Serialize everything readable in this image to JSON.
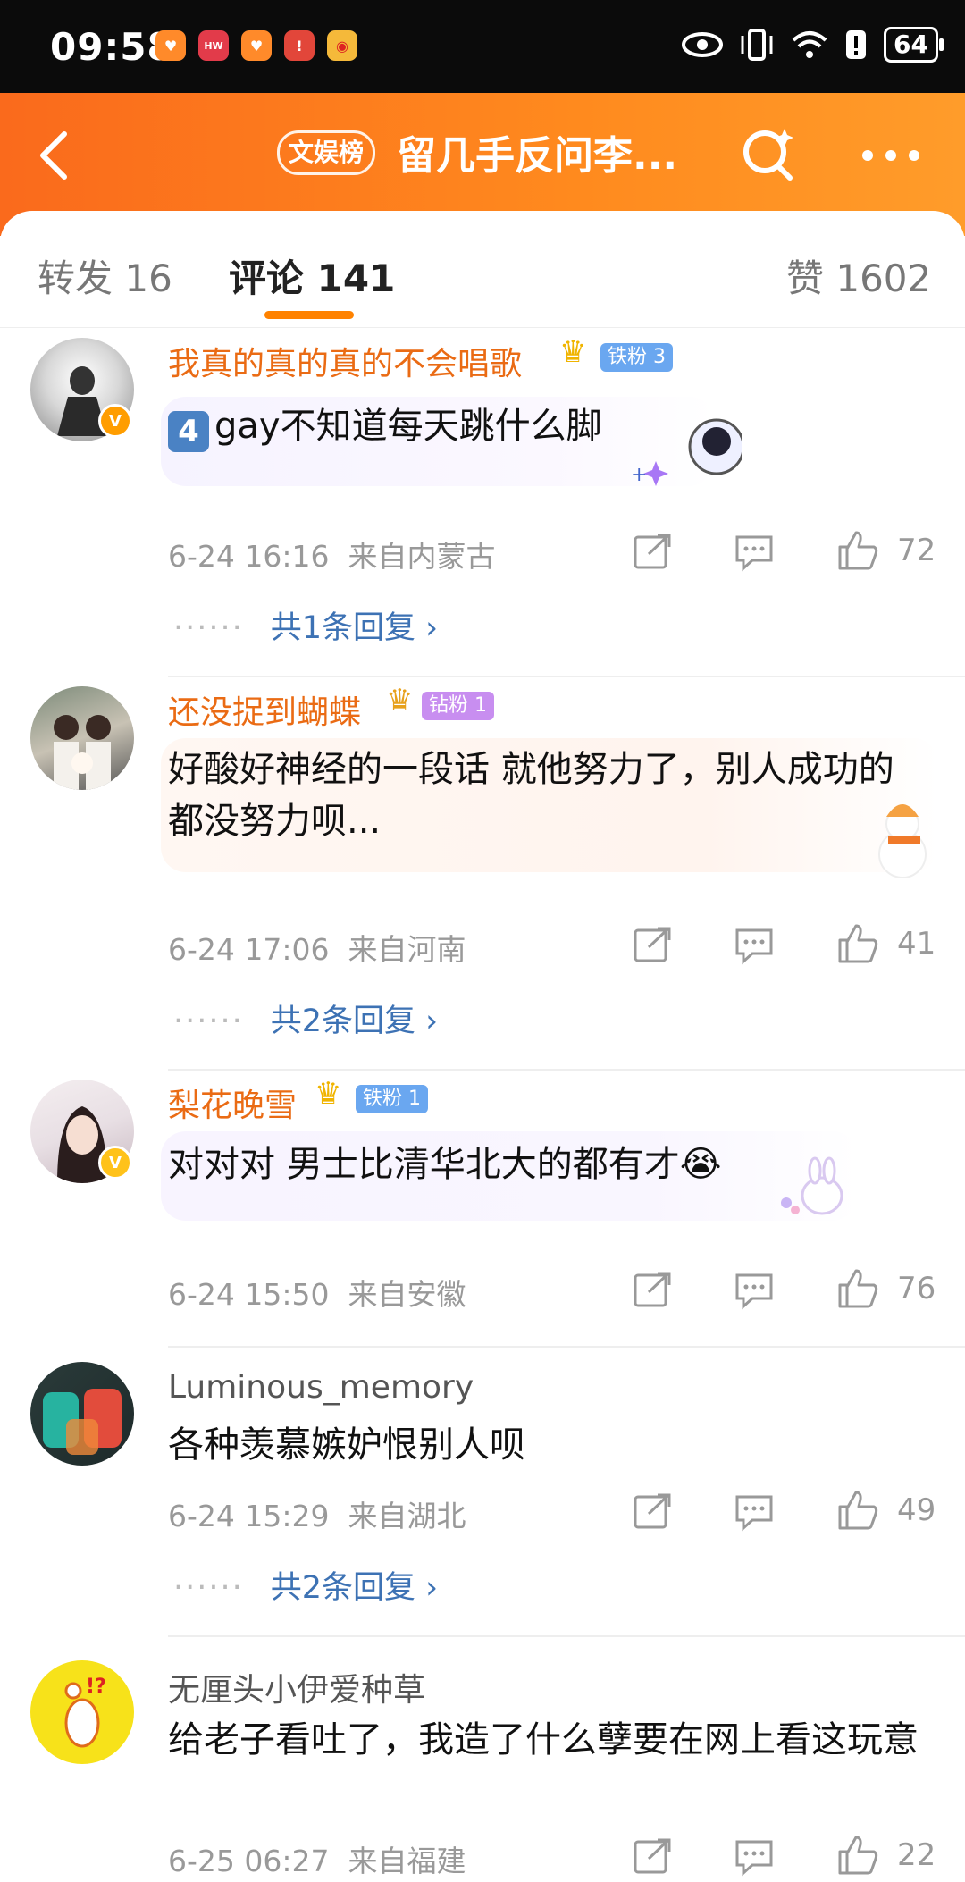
{
  "status_bar": {
    "time": "09:58",
    "battery": "64",
    "apps": [
      {
        "icon": "health-app-icon",
        "color": "#ff8a2a",
        "glyph": "♥"
      },
      {
        "icon": "huawei-app-icon",
        "color": "#e23b4a",
        "glyph": "H"
      },
      {
        "icon": "health2-app-icon",
        "color": "#ff8a2a",
        "glyph": "♥"
      },
      {
        "icon": "alert-app-icon",
        "color": "#e2463a",
        "glyph": "!"
      },
      {
        "icon": "weibo-app-icon",
        "color": "#f5b93a",
        "glyph": "◉"
      }
    ]
  },
  "header": {
    "tag": "文娱榜",
    "title": "留几手反问李..."
  },
  "tabs": [
    {
      "label": "转发 16"
    },
    {
      "label": "评论 141"
    },
    {
      "label": "赞 1602"
    }
  ],
  "comments": [
    {
      "username": "我真的真的真的不会唱歌",
      "badge": "铁粉 3",
      "badge_color": "#6aa7f0",
      "level_prefix": "4",
      "text": "gay不知道每天跳什么脚",
      "date": "6-24 16:16",
      "location": "来自内蒙古",
      "likes": "72",
      "replies": "共1条回复 ›"
    },
    {
      "username": "还没捉到蝴蝶",
      "badge": "钻粉 1",
      "badge_color": "#c88ef0",
      "text": "好酸好神经的一段话 就他努力了，别人成功的都没努力呗...",
      "date": "6-24 17:06",
      "location": "来自河南",
      "likes": "41",
      "replies": "共2条回复 ›"
    },
    {
      "username": "梨花晚雪",
      "badge": "铁粉 1",
      "badge_color": "#6aa7f0",
      "text": "对对对 男士比清华北大的都有才😭",
      "date": "6-24 15:50",
      "location": "来自安徽",
      "likes": "76"
    },
    {
      "username": "Luminous_memory",
      "text": "各种羡慕嫉妒恨别人呗",
      "date": "6-24 15:29",
      "location": "来自湖北",
      "likes": "49",
      "replies": "共2条回复 ›"
    },
    {
      "username": "无厘头小伊爱种草",
      "text": "给老子看吐了，我造了什么孽要在网上看这玩意",
      "date": "6-25 06:27",
      "location": "来自福建",
      "likes": "22"
    }
  ],
  "colors": {
    "accent": "#ff8200",
    "link": "#3d72b4",
    "vip_name": "#ea6b14"
  }
}
